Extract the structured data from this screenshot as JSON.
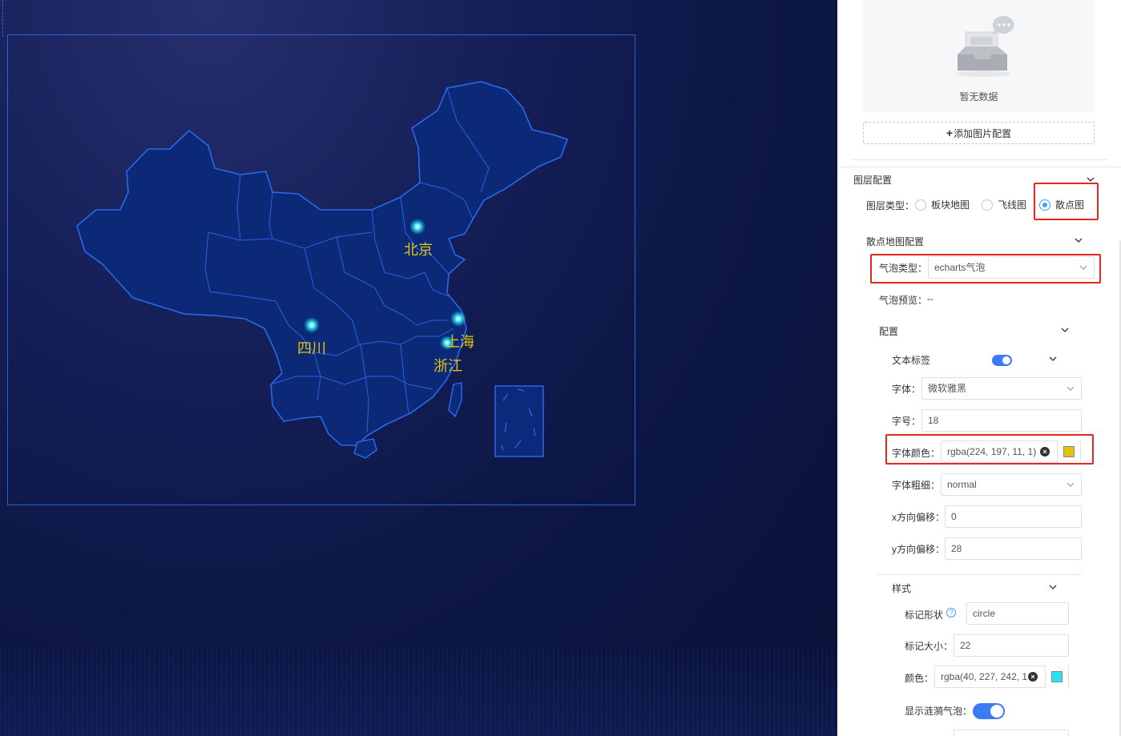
{
  "map": {
    "cities": [
      {
        "name": "北京"
      },
      {
        "name": "四川"
      },
      {
        "name": "上海"
      },
      {
        "name": "浙江"
      }
    ],
    "label_color": "#e0c50b",
    "bubble_color": "#28e3f2"
  },
  "panel": {
    "empty_text": "暂无数据",
    "add_image_label": "添加图片配置",
    "layer_config": {
      "title": "图层配置",
      "type_label": "图层类型：",
      "options": [
        "板块地图",
        "飞线图",
        "散点图"
      ],
      "selected": "散点图"
    },
    "scatter_config": {
      "title": "散点地图配置",
      "bubble_type_label": "气泡类型：",
      "bubble_type_value": "echarts气泡",
      "bubble_preview_label": "气泡预览：",
      "bubble_preview_value": "--",
      "config_title": "配置",
      "text_label": {
        "title": "文本标签",
        "font_label": "字体：",
        "font_value": "微软雅黑",
        "size_label": "字号：",
        "size_value": "18",
        "color_label": "字体颜色：",
        "color_value": "rgba(224, 197, 11, 1)",
        "color_swatch": "#e0c50b",
        "weight_label": "字体粗细：",
        "weight_value": "normal",
        "x_offset_label": "x方向偏移：",
        "x_offset_value": "0",
        "y_offset_label": "y方向偏移：",
        "y_offset_value": "28"
      },
      "style": {
        "title": "样式",
        "shape_label": "标记形状",
        "shape_value": "circle",
        "size_label": "标记大小：",
        "size_value": "22",
        "color_label": "颜色：",
        "color_value": "rgba(40, 227, 242, 1",
        "color_swatch": "#28e3f2",
        "ripple_label": "显示涟漪气泡："
      }
    }
  }
}
